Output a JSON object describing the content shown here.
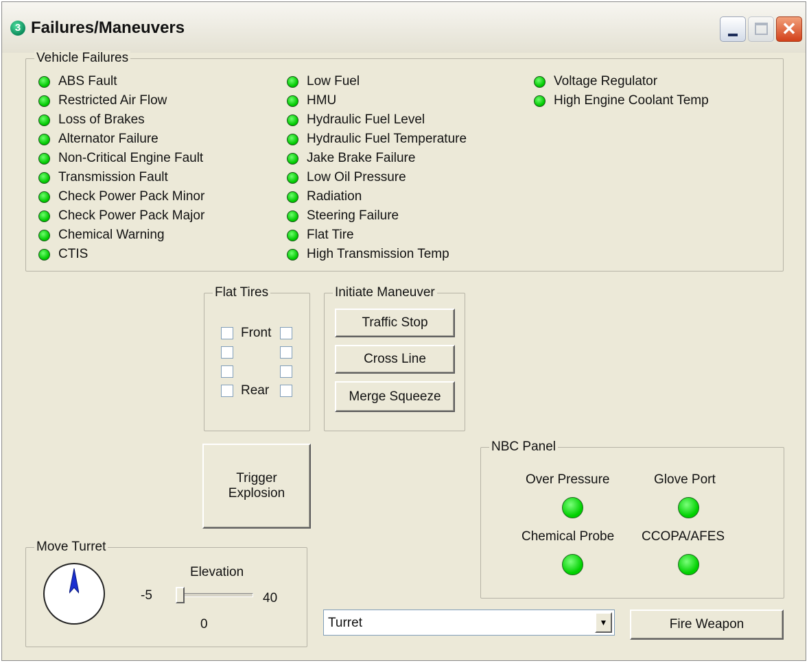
{
  "window": {
    "title": "Failures/Maneuvers",
    "icon_glyph": "3",
    "close_glyph": "✕"
  },
  "vehicle_failures": {
    "legend": "Vehicle Failures",
    "col1": [
      "ABS Fault",
      "Restricted Air Flow",
      "Loss of Brakes",
      "Alternator Failure",
      "Non-Critical Engine Fault",
      "Transmission Fault",
      "Check Power Pack Minor",
      "Check Power Pack Major",
      "Chemical Warning",
      "CTIS"
    ],
    "col2": [
      "Low Fuel",
      "HMU",
      "Hydraulic Fuel Level",
      "Hydraulic Fuel Temperature",
      "Jake Brake Failure",
      "Low Oil Pressure",
      "Radiation",
      "Steering Failure",
      "Flat Tire",
      "High Transmission Temp"
    ],
    "col3": [
      "Voltage Regulator",
      "High Engine Coolant Temp"
    ],
    "led_color": "#00c800"
  },
  "flat_tires": {
    "legend": "Flat Tires",
    "front_label": "Front",
    "rear_label": "Rear"
  },
  "maneuver": {
    "legend": "Initiate Maneuver",
    "traffic_stop": "Traffic Stop",
    "cross_line": "Cross Line",
    "merge_squeeze": "Merge Squeeze"
  },
  "trigger": {
    "line1": "Trigger",
    "line2": "Explosion"
  },
  "nbc": {
    "legend": "NBC Panel",
    "over_pressure": "Over Pressure",
    "glove_port": "Glove Port",
    "chemical_probe": "Chemical Probe",
    "ccopa": "CCOPA/AFES"
  },
  "turret": {
    "legend": "Move Turret",
    "elevation_label": "Elevation",
    "min": "-5",
    "max": "40",
    "value": "0"
  },
  "weapon_select": {
    "value": "Turret",
    "arrow": "▼"
  },
  "fire_button": "Fire Weapon"
}
